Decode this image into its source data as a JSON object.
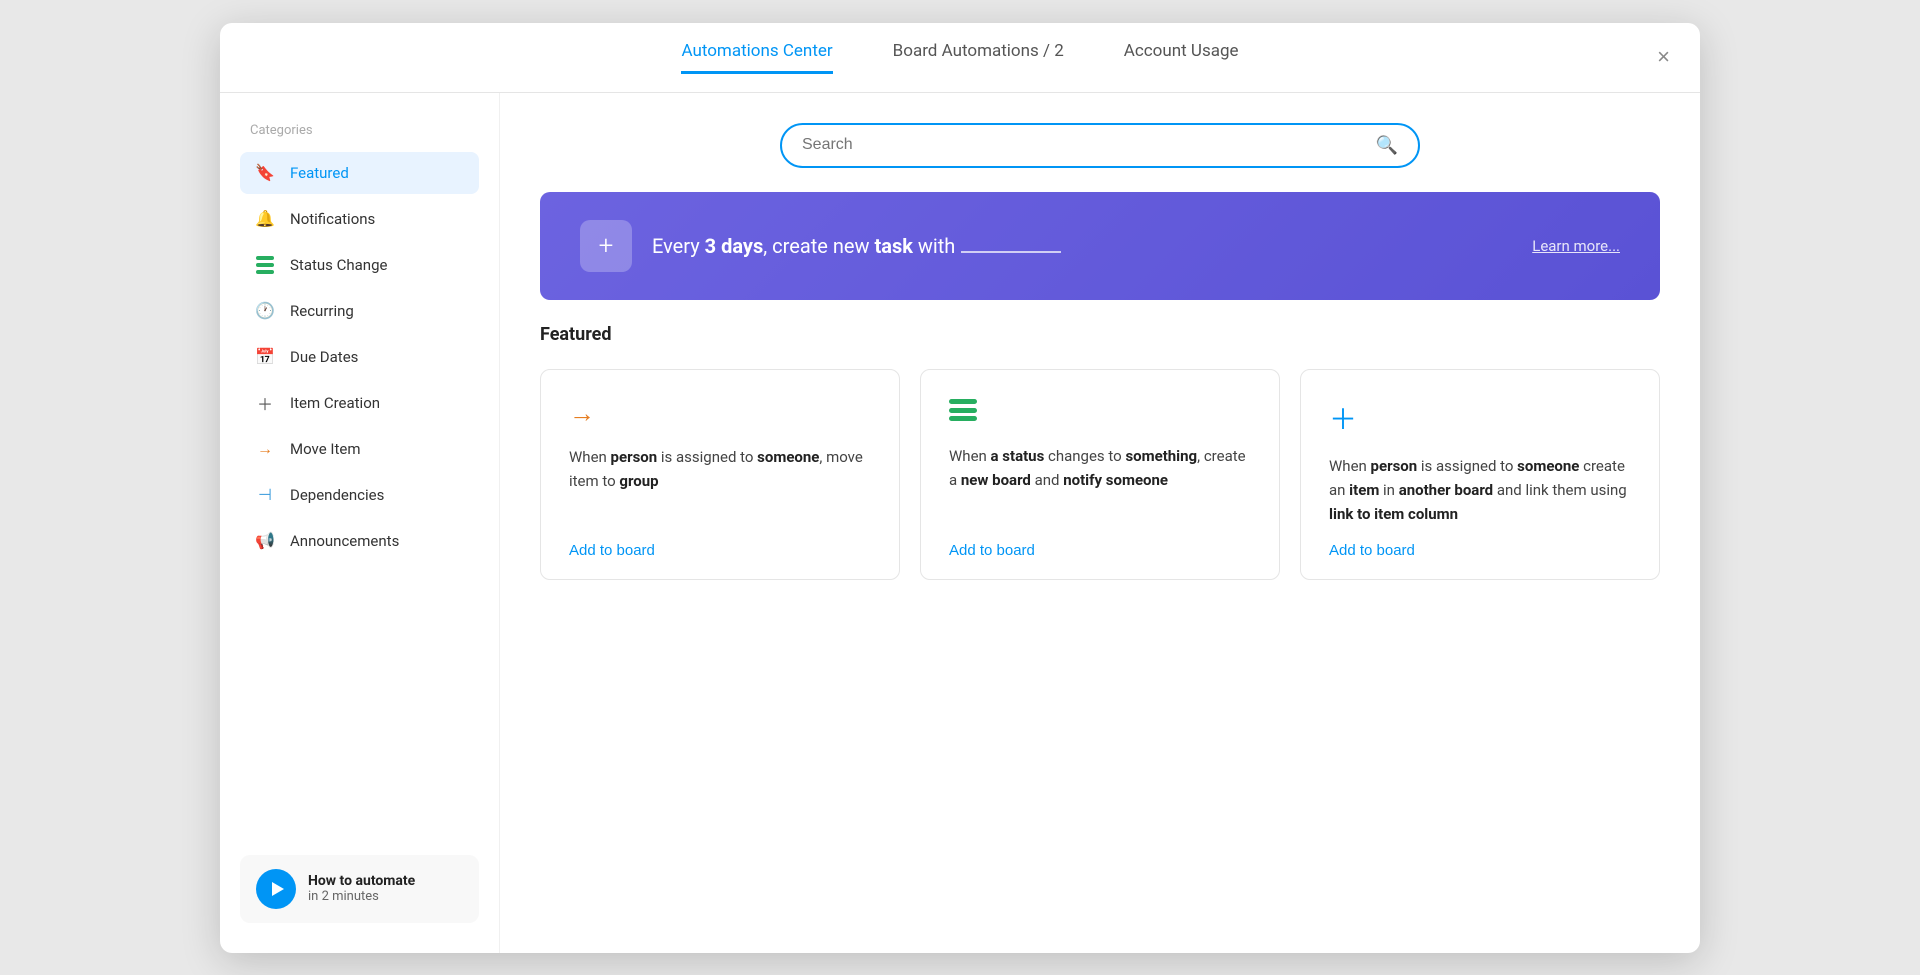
{
  "modal": {
    "title": "Automations Center"
  },
  "header": {
    "tabs": [
      {
        "id": "automations-center",
        "label": "Automations Center",
        "active": true
      },
      {
        "id": "board-automations",
        "label": "Board Automations / 2",
        "active": false
      },
      {
        "id": "account-usage",
        "label": "Account Usage",
        "active": false
      }
    ],
    "close_label": "×"
  },
  "sidebar": {
    "categories_label": "Categories",
    "items": [
      {
        "id": "featured",
        "label": "Featured",
        "icon": "bookmark",
        "active": true
      },
      {
        "id": "notifications",
        "label": "Notifications",
        "icon": "bell",
        "active": false
      },
      {
        "id": "status-change",
        "label": "Status Change",
        "icon": "status",
        "active": false
      },
      {
        "id": "recurring",
        "label": "Recurring",
        "icon": "clock",
        "active": false
      },
      {
        "id": "due-dates",
        "label": "Due Dates",
        "icon": "calendar",
        "active": false
      },
      {
        "id": "item-creation",
        "label": "Item Creation",
        "icon": "plus",
        "active": false
      },
      {
        "id": "move-item",
        "label": "Move Item",
        "icon": "arrow",
        "active": false
      },
      {
        "id": "dependencies",
        "label": "Dependencies",
        "icon": "deps",
        "active": false
      },
      {
        "id": "announcements",
        "label": "Announcements",
        "icon": "announce",
        "active": false
      }
    ],
    "video": {
      "title": "How to automate",
      "subtitle": "in 2 minutes"
    }
  },
  "search": {
    "placeholder": "Search"
  },
  "banner": {
    "icon": "+",
    "text_prefix": "Every ",
    "text_bold1": "3 days",
    "text_mid": ", create new ",
    "text_bold2": "task",
    "text_suffix": " with",
    "learn_more": "Learn more..."
  },
  "featured": {
    "section_title": "Featured",
    "cards": [
      {
        "id": "card-1",
        "icon_type": "arrow",
        "icon_unicode": "→",
        "body_html": "When <strong>person</strong> is assigned to <strong>someone</strong>, move item to <strong>group</strong>",
        "add_label": "Add to board"
      },
      {
        "id": "card-2",
        "icon_type": "status",
        "icon_unicode": "≡",
        "body_html": "When <strong>a status</strong> changes to <strong>something</strong>, create a <strong>new board</strong> and <strong>notify someone</strong>",
        "add_label": "Add to board"
      },
      {
        "id": "card-3",
        "icon_type": "plus",
        "icon_unicode": "+",
        "body_html": "When <strong>person</strong> is assigned to <strong>someone</strong> create an <strong>item</strong> in <strong>another board</strong> and link them using <strong>link to item column</strong>",
        "add_label": "Add to board"
      }
    ]
  }
}
